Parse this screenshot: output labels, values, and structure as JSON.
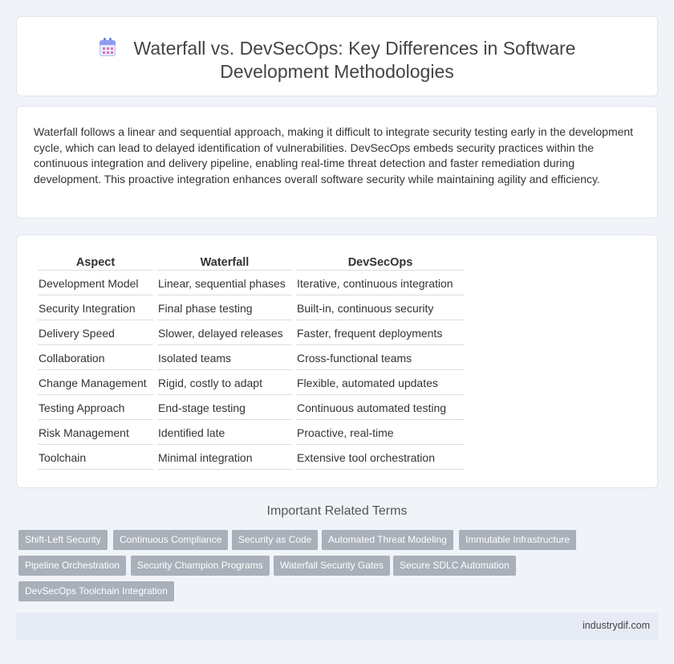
{
  "header": {
    "title_line1": "Waterfall vs. DevSecOps: Key Differences in Software",
    "title_line2": "Development Methodologies",
    "icon": "calendar-icon"
  },
  "intro": {
    "text": "Waterfall follows a linear and sequential approach, making it difficult to integrate security testing early in the development cycle, which can lead to delayed identification of vulnerabilities. DevSecOps embeds security practices within the continuous integration and delivery pipeline, enabling real-time threat detection and faster remediation during development. This proactive integration enhances overall software security while maintaining agility and efficiency."
  },
  "table": {
    "headers": [
      "Aspect",
      "Waterfall",
      "DevSecOps"
    ],
    "rows": [
      [
        "Development Model",
        "Linear, sequential phases",
        "Iterative, continuous integration"
      ],
      [
        "Security Integration",
        "Final phase testing",
        "Built-in, continuous security"
      ],
      [
        "Delivery Speed",
        "Slower, delayed releases",
        "Faster, frequent deployments"
      ],
      [
        "Collaboration",
        "Isolated teams",
        "Cross-functional teams"
      ],
      [
        "Change Management",
        "Rigid, costly to adapt",
        "Flexible, automated updates"
      ],
      [
        "Testing Approach",
        "End-stage testing",
        "Continuous automated testing"
      ],
      [
        "Risk Management",
        "Identified late",
        "Proactive, real-time"
      ],
      [
        "Toolchain",
        "Minimal integration",
        "Extensive tool orchestration"
      ]
    ]
  },
  "related": {
    "title": "Important Related Terms",
    "tags": [
      "Shift-Left Security",
      "Continuous Compliance",
      "Security as Code",
      "Automated Threat Modeling",
      "Immutable Infrastructure",
      "Pipeline Orchestration",
      "Security Champion Programs",
      "Waterfall Security Gates",
      "Secure SDLC Automation",
      "DevSecOps Toolchain Integration"
    ]
  },
  "footer": {
    "site": "industrydif.com"
  }
}
